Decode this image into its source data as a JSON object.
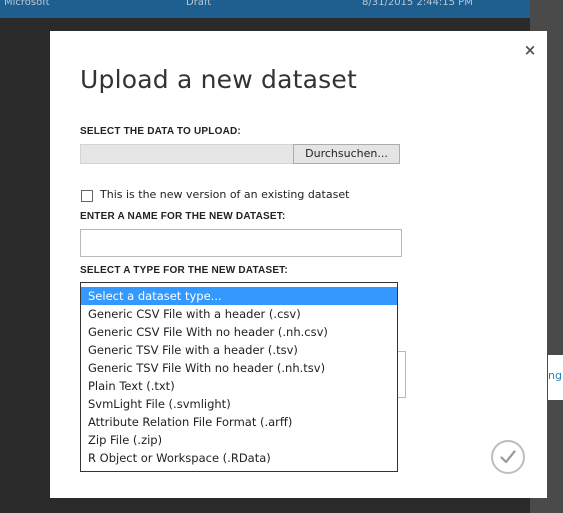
{
  "background": {
    "row": [
      "Microsoft",
      "Draft",
      "8/31/2015 2:44:15 PM"
    ],
    "side_link": "ng «"
  },
  "dialog": {
    "close_glyph": "×",
    "title": "Upload a new dataset",
    "select_data_label": "SELECT THE DATA TO UPLOAD:",
    "file_path_value": "",
    "browse_label": "Durchsuchen...",
    "new_version_label": "This is the new version of an existing dataset",
    "new_version_checked": false,
    "name_label": "ENTER A NAME FOR THE NEW DATASET:",
    "name_value": "",
    "type_label": "SELECT A TYPE FOR THE NEW DATASET:",
    "type_options": [
      "Select a dataset type...",
      "Generic CSV File with a header (.csv)",
      "Generic CSV File With no header (.nh.csv)",
      "Generic TSV File with a header (.tsv)",
      "Generic TSV File With no header (.nh.tsv)",
      "Plain Text (.txt)",
      "SvmLight File (.svmlight)",
      "Attribute Relation File Format (.arff)",
      "Zip File (.zip)",
      "R Object or Workspace (.RData)"
    ],
    "selected_option_index": 0,
    "ok_icon": "checkmark-icon"
  },
  "colors": {
    "selection": "#3399ff",
    "overlay": "#2b2b2b",
    "header_bar": "#1f5f8f"
  }
}
